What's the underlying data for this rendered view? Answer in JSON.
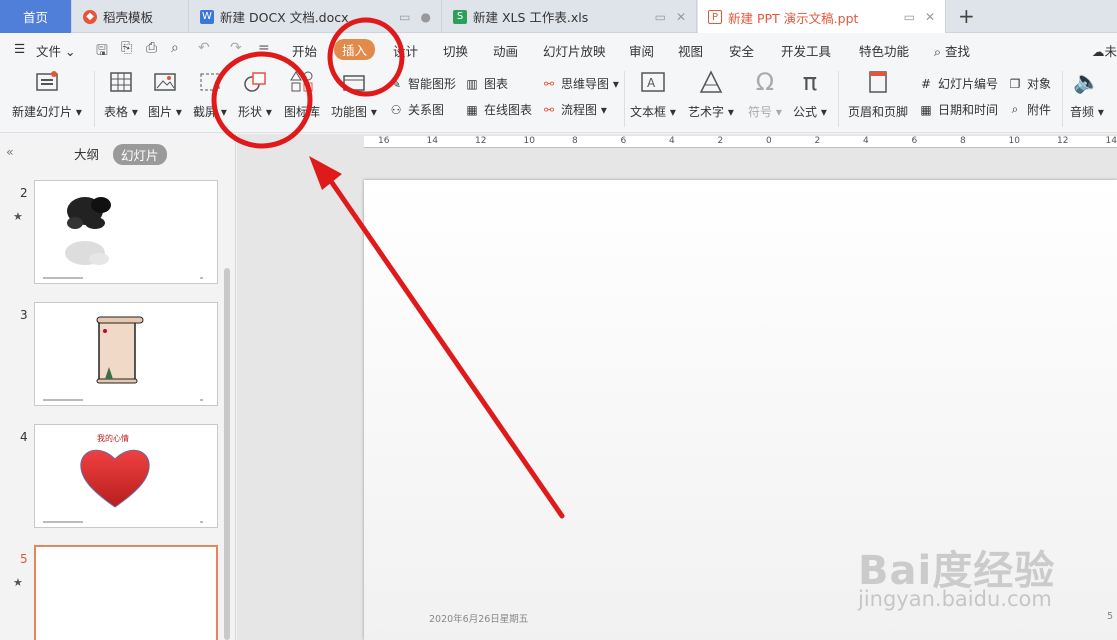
{
  "tabs": {
    "home": "首页",
    "items": [
      {
        "label": "稻壳模板",
        "icon": "daoke-icon"
      },
      {
        "label": "新建 DOCX 文档.docx",
        "icon": "word-doc-icon"
      },
      {
        "label": "新建 XLS 工作表.xls",
        "icon": "excel-sheet-icon"
      },
      {
        "label": "新建 PPT 演示文稿.ppt",
        "icon": "ppt-doc-icon"
      }
    ]
  },
  "menu": {
    "file": "文件",
    "items": [
      "开始",
      "插入",
      "设计",
      "切换",
      "动画",
      "幻灯片放映",
      "审阅",
      "视图",
      "安全",
      "开发工具",
      "特色功能"
    ],
    "active": "插入",
    "search": "查找",
    "cloud_partial": "未"
  },
  "ribbon": {
    "new_slide": "新建幻灯片",
    "table": "表格",
    "picture": "图片",
    "screenshot": "截屏",
    "shape": "形状",
    "icon_lib": "图标库",
    "function_chart": "功能图",
    "smart_art": "智能图形",
    "chart": "图表",
    "relation": "关系图",
    "online_chart": "在线图表",
    "mind_map": "思维导图",
    "flow_chart": "流程图",
    "text_box": "文本框",
    "art_text": "艺术字",
    "symbol": "符号",
    "formula": "公式",
    "header_footer": "页眉和页脚",
    "slide_number": "幻灯片编号",
    "date_time": "日期和时间",
    "object": "对象",
    "attachment": "附件",
    "audio": "音频"
  },
  "left_panel": {
    "outline_tab": "大纲",
    "slides_tab": "幻灯片",
    "slides": [
      {
        "number": "2",
        "starred": true
      },
      {
        "number": "3",
        "starred": false
      },
      {
        "number": "4",
        "starred": false,
        "title": "我的心情"
      },
      {
        "number": "5",
        "starred": true,
        "selected": true
      }
    ]
  },
  "ruler": {
    "ticks": [
      "16",
      "14",
      "12",
      "10",
      "8",
      "6",
      "4",
      "2",
      "0",
      "2",
      "4",
      "6",
      "8",
      "10",
      "12",
      "14"
    ]
  },
  "slide": {
    "footer_date": "2020年6月26日星期五",
    "page_number": "5"
  },
  "watermark": {
    "logo": "Bai度经验",
    "url": "jingyan.baidu.com"
  },
  "colors": {
    "accent": "#e28a4a",
    "annotation": "#e01a1a",
    "home_tab": "#4f7fd8"
  }
}
